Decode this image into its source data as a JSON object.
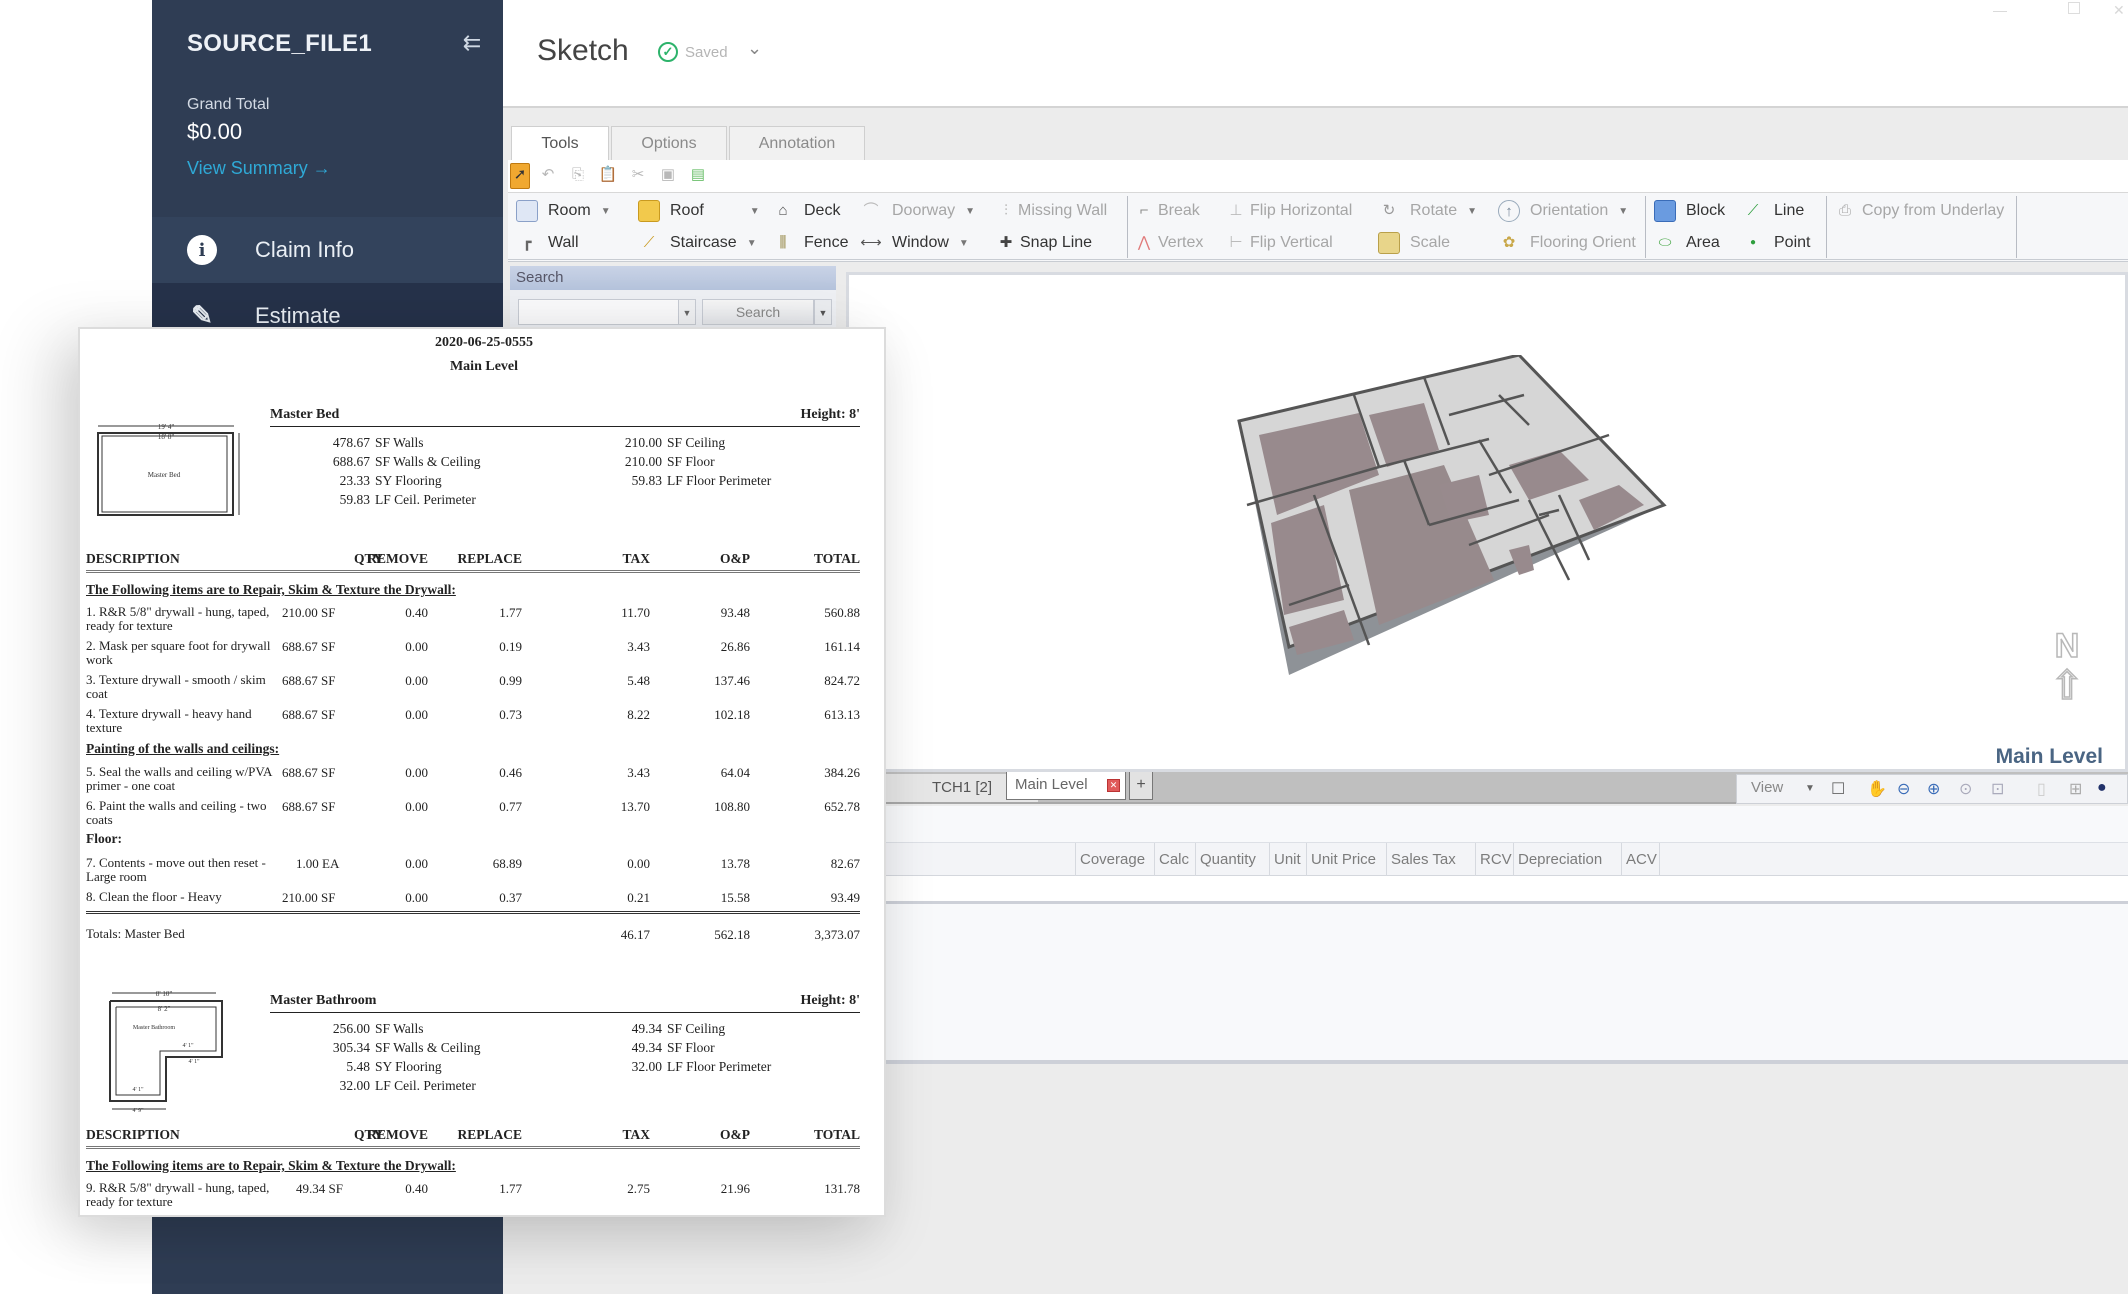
{
  "sidebar": {
    "file_title": "SOURCE_FILE1",
    "grand_total_label": "Grand Total",
    "grand_total_value": "$0.00",
    "view_summary": "View Summary →",
    "nav": [
      {
        "label": "Claim Info",
        "icon": "info-icon"
      },
      {
        "label": "Estimate",
        "icon": "pencil-ruler-icon"
      }
    ]
  },
  "header": {
    "title": "Sketch",
    "status": "Saved"
  },
  "ribbon": {
    "tabs": [
      "Tools",
      "Options",
      "Annotation"
    ],
    "active_tab": "Tools",
    "groups": {
      "draw": [
        "Room",
        "Wall",
        "Roof",
        "Staircase",
        "Deck",
        "Fence",
        "Doorway",
        "Window",
        "Missing Wall",
        "Snap Line"
      ],
      "edit": [
        "Break",
        "Vertex",
        "Flip Horizontal",
        "Flip Vertical",
        "Rotate",
        "Scale",
        "Orientation",
        "Flooring Orient"
      ],
      "shapes": [
        "Block",
        "Area",
        "Line",
        "Point"
      ],
      "underlay": [
        "Copy from Underlay"
      ]
    }
  },
  "search": {
    "header": "Search",
    "input_value": "",
    "button": "Search"
  },
  "canvas": {
    "compass": "N",
    "level_label": "Main Level"
  },
  "sheet_bar": {
    "sketch_select": "TCH1  [2]",
    "tabs": [
      "Main Level"
    ],
    "add": "+",
    "view_label": "View"
  },
  "grid": {
    "columns": [
      "Coverage",
      "Calc",
      "Quantity",
      "Unit",
      "Unit Price",
      "Sales Tax",
      "RCV",
      "Depreciation",
      "ACV"
    ]
  },
  "document": {
    "id": "2020-06-25-0555",
    "level": "Main Level",
    "columns": [
      "DESCRIPTION",
      "QTY",
      "REMOVE",
      "REPLACE",
      "TAX",
      "O&P",
      "TOTAL"
    ],
    "rooms": [
      {
        "name": "Master Bed",
        "height": "Height: 8'",
        "sketch": {
          "outer": "19' 4\"",
          "inner": "18' 8\"",
          "label": "Master Bed"
        },
        "measurements_left": [
          {
            "value": "478.67",
            "label": "SF Walls"
          },
          {
            "value": "688.67",
            "label": "SF Walls & Ceiling"
          },
          {
            "value": "23.33",
            "label": "SY Flooring"
          },
          {
            "value": "59.83",
            "label": "LF Ceil. Perimeter"
          }
        ],
        "measurements_right": [
          {
            "value": "210.00",
            "label": "SF Ceiling"
          },
          {
            "value": "210.00",
            "label": "SF Floor"
          },
          {
            "value": "59.83",
            "label": "LF Floor Perimeter"
          }
        ],
        "sections": [
          {
            "title": "The Following items are to Repair, Skim & Texture the Drywall:",
            "items": [
              {
                "desc": "1.  R&R 5/8\" drywall - hung, taped, ready for texture",
                "qty": "210.00 SF",
                "remove": "0.40",
                "replace": "1.77",
                "tax": "11.70",
                "op": "93.48",
                "total": "560.88"
              },
              {
                "desc": "2.  Mask per square foot for drywall work",
                "qty": "688.67 SF",
                "remove": "0.00",
                "replace": "0.19",
                "tax": "3.43",
                "op": "26.86",
                "total": "161.14"
              },
              {
                "desc": "3.  Texture drywall - smooth / skim coat",
                "qty": "688.67 SF",
                "remove": "0.00",
                "replace": "0.99",
                "tax": "5.48",
                "op": "137.46",
                "total": "824.72"
              },
              {
                "desc": "4.  Texture drywall - heavy hand texture",
                "qty": "688.67 SF",
                "remove": "0.00",
                "replace": "0.73",
                "tax": "8.22",
                "op": "102.18",
                "total": "613.13"
              }
            ]
          },
          {
            "title": "Painting of the walls and ceilings:",
            "items": [
              {
                "desc": "5.  Seal the walls and ceiling w/PVA primer - one coat",
                "qty": "688.67 SF",
                "remove": "0.00",
                "replace": "0.46",
                "tax": "3.43",
                "op": "64.04",
                "total": "384.26"
              },
              {
                "desc": "6.  Paint the walls and ceiling - two coats",
                "qty": "688.67 SF",
                "remove": "0.00",
                "replace": "0.77",
                "tax": "13.70",
                "op": "108.80",
                "total": "652.78"
              }
            ]
          },
          {
            "title": "Floor:",
            "items": [
              {
                "desc": "7.  Contents - move out then reset - Large room",
                "qty": "1.00 EA",
                "remove": "0.00",
                "replace": "68.89",
                "tax": "0.00",
                "op": "13.78",
                "total": "82.67"
              },
              {
                "desc": "8.  Clean the floor - Heavy",
                "qty": "210.00 SF",
                "remove": "0.00",
                "replace": "0.37",
                "tax": "0.21",
                "op": "15.58",
                "total": "93.49"
              }
            ]
          }
        ],
        "totals": {
          "label": "Totals:  Master Bed",
          "tax": "46.17",
          "op": "562.18",
          "total": "3,373.07"
        }
      },
      {
        "name": "Master Bathroom",
        "height": "Height: 8'",
        "sketch": {
          "outer": "8' 10\"",
          "inner": "8' 2\"",
          "label": "Master Bathroom",
          "dims": [
            "4' 1\"",
            "4' 1\"",
            "4' 1\"",
            "4' 9\""
          ]
        },
        "measurements_left": [
          {
            "value": "256.00",
            "label": "SF Walls"
          },
          {
            "value": "305.34",
            "label": "SF Walls & Ceiling"
          },
          {
            "value": "5.48",
            "label": "SY Flooring"
          },
          {
            "value": "32.00",
            "label": "LF Ceil. Perimeter"
          }
        ],
        "measurements_right": [
          {
            "value": "49.34",
            "label": "SF Ceiling"
          },
          {
            "value": "49.34",
            "label": "SF Floor"
          },
          {
            "value": "32.00",
            "label": "LF Floor Perimeter"
          }
        ],
        "sections": [
          {
            "title": "The Following items are to Repair, Skim & Texture the Drywall:",
            "items": [
              {
                "desc": "9.  R&R 5/8\" drywall - hung, taped, ready for texture",
                "qty": "49.34 SF",
                "remove": "0.40",
                "replace": "1.77",
                "tax": "2.75",
                "op": "21.96",
                "total": "131.78"
              }
            ]
          }
        ]
      }
    ]
  },
  "colors": {
    "sidebar_bg": "#2f3d54",
    "link": "#2fa9d6",
    "saved_green": "#2db36b",
    "level_label": "#4a6583",
    "floor": "#9a8d8f",
    "wall": "#d9d9d9"
  }
}
